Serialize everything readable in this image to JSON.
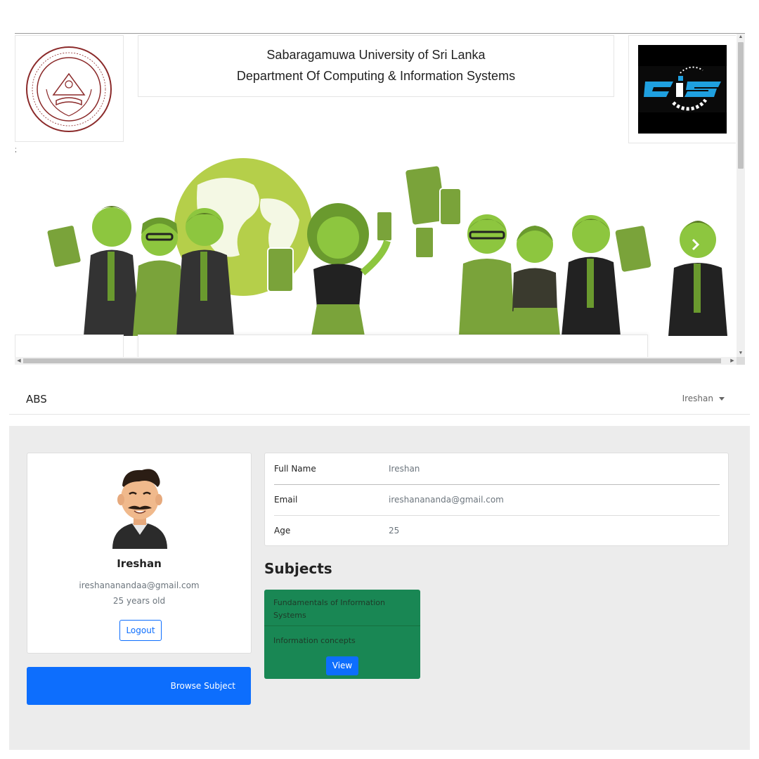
{
  "header_frame": {
    "university_name": "Sabaragamuwa University of Sri Lanka",
    "department_name": "Department Of Computing & Information Systems",
    "stray_char": ";",
    "university_logo_icon": "university-seal-icon",
    "department_logo_icon": "cis-logo-icon",
    "banner_image": "people-with-tablets-illustration",
    "banner_next_icon": "chevron-right-icon"
  },
  "navbar": {
    "brand": "ABS",
    "user_menu_label": "Ireshan"
  },
  "profile": {
    "name": "Ireshan",
    "email": "ireshananandaa@gmail.com",
    "age_text": "25 years old",
    "logout_label": "Logout",
    "avatar_icon": "user-avatar-icon"
  },
  "browse": {
    "label": "Browse Subject"
  },
  "details": {
    "rows": [
      {
        "label": "Full Name",
        "value": "Ireshan"
      },
      {
        "label": "Email",
        "value": "ireshanananda@gmail.com"
      },
      {
        "label": "Age",
        "value": "25"
      }
    ]
  },
  "subjects": {
    "heading": "Subjects",
    "items": [
      {
        "title": "Fundamentals of Information Systems",
        "description": "Information concepts",
        "button_label": "View"
      }
    ]
  },
  "colors": {
    "primary": "#0d6efd",
    "success": "#198754",
    "page_gray": "#ececec",
    "banner_green": "#8dc63f"
  }
}
